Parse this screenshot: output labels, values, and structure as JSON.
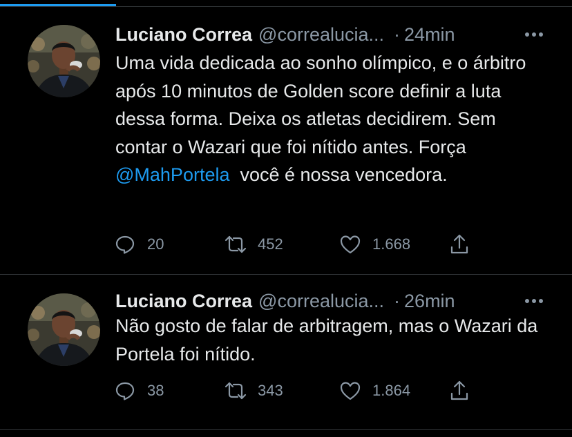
{
  "tweets": [
    {
      "author": "Luciano Correa",
      "handle": "@correalucia...",
      "separator": "·",
      "time": "24min",
      "text_before": "Uma vida dedicada ao sonho olímpico, e o árbitro após 10 minutos de Golden score definir a luta dessa forma. Deixa os atletas decidirem. Sem contar o Wazari que foi nítido antes. Força ",
      "mention": "@MahPortela",
      "text_after": "  você é nossa vencedora.",
      "replies": "20",
      "retweets": "452",
      "likes": "1.668",
      "icons": [
        "reply-icon",
        "retweet-icon",
        "like-icon",
        "share-icon",
        "more-icon"
      ]
    },
    {
      "author": "Luciano Correa",
      "handle": "@correalucia...",
      "separator": "·",
      "time": "26min",
      "text": "Não gosto de falar de arbitragem, mas o Wazari da Portela foi nítido.",
      "replies": "38",
      "retweets": "343",
      "likes": "1.864",
      "icons": [
        "reply-icon",
        "retweet-icon",
        "like-icon",
        "share-icon",
        "more-icon"
      ]
    }
  ],
  "colors": {
    "background": "#000000",
    "text": "#e7e9ea",
    "secondary": "#8b98a5",
    "accent": "#1d9bf0",
    "divider": "#2f3336"
  }
}
